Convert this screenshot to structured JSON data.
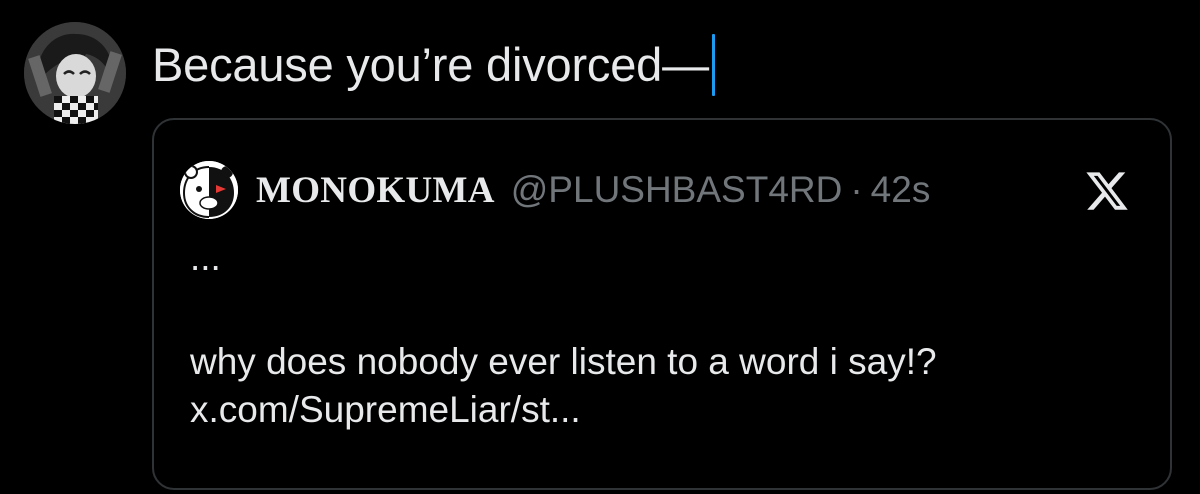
{
  "composer": {
    "text": "Because you’re divorced—",
    "avatar_icon": "character-avatar-icon"
  },
  "quote": {
    "display_name": "MONOKUMA",
    "handle": "@PLUSHBAST4RD",
    "separator": "·",
    "time": "42s",
    "avatar_icon": "monokuma-avatar-icon",
    "platform_icon": "x-logo-icon",
    "ellipsis": "...",
    "text": "why does nobody ever listen to a word i say!?",
    "link": "x.com/SupremeLiar/st..."
  },
  "colors": {
    "background": "#000000",
    "text_primary": "#e7e9ea",
    "text_secondary": "#71767b",
    "card_border": "#2f3336",
    "caret": "#1d9bf0"
  }
}
